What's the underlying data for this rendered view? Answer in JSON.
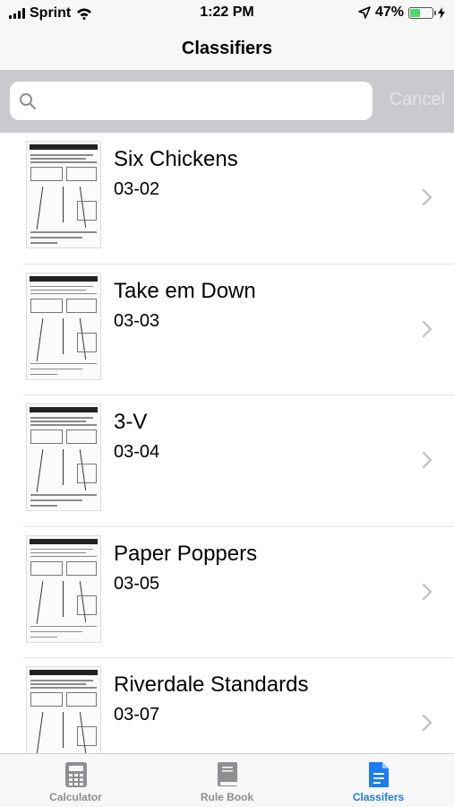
{
  "status_bar": {
    "carrier": "Sprint",
    "time": "1:22 PM",
    "battery_percent": "47%",
    "battery_level": 0.47
  },
  "nav": {
    "title": "Classifiers"
  },
  "search": {
    "placeholder": "",
    "value": "",
    "cancel_label": "Cancel"
  },
  "classifiers": [
    {
      "title": "Six Chickens",
      "code": "03-02"
    },
    {
      "title": "Take em Down",
      "code": "03-03"
    },
    {
      "title": "3-V",
      "code": "03-04"
    },
    {
      "title": "Paper Poppers",
      "code": "03-05"
    },
    {
      "title": "Riverdale Standards",
      "code": "03-07"
    }
  ],
  "tabs": [
    {
      "label": "Calculator",
      "icon": "calculator-icon",
      "active": false
    },
    {
      "label": "Rule Book",
      "icon": "book-icon",
      "active": false
    },
    {
      "label": "Classifers",
      "icon": "document-icon",
      "active": true
    }
  ],
  "colors": {
    "accent": "#1a7df2",
    "inactive": "#8e8e93",
    "search_bg": "#c9c9ce",
    "battery": "#4cd964"
  }
}
